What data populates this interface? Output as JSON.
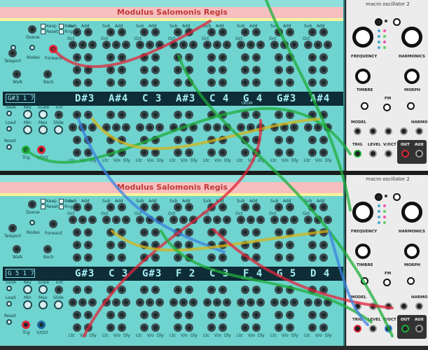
{
  "modules": {
    "msr_title": "Modulus Salomonis Regis",
    "macro_title": "macro oscillator 2"
  },
  "rack1": {
    "display_small": "G#3 1 7",
    "steps": [
      "D#3",
      "A#4",
      "C 3",
      "A#3",
      "C 4",
      "G 4",
      "G#3",
      "A#4"
    ],
    "delim": "DELIM"
  },
  "rack2": {
    "display_small": "G 5 1 7",
    "steps": [
      "G#3",
      "C 3",
      "G#3",
      "F 2",
      "C 3",
      "F 4",
      "G 5",
      "D 4"
    ],
    "delim": "DELIM"
  },
  "msr_labels": {
    "queue": "Queue",
    "keep": "Keep",
    "new": "New",
    "reset": "Reset",
    "rng": "Rng",
    "teleport": "Teleport",
    "nodes": "Nodes",
    "forward": "Forward",
    "walk": "Walk",
    "back": "Back",
    "save": "Save",
    "key": "Key",
    "scale": "Scale",
    "ext": "Ext",
    "load": "Load",
    "min": "Min",
    "max": "Max",
    "slide": "Slide",
    "reset2": "Reset",
    "trig": "Trig",
    "voct": "V/Oct",
    "add": "Add",
    "sub": "Sub",
    "oct": "Oct",
    "ltc": "Ltc",
    "vo": "V/o",
    "dly": "Dly"
  },
  "macro_labels": {
    "frequency": "FREQUENCY",
    "harmonics": "HARMONICS",
    "timbre": "TIMBRE",
    "morph": "MORPH",
    "fm": "FM",
    "model": "MODEL",
    "harmo": "HARMO",
    "trig": "TRIG",
    "level": "LEVEL",
    "voct": "V/OCT",
    "out": "OUT",
    "aux": "AUX"
  },
  "colors": {
    "panel": "#6fd3cf",
    "title_band": "#f7bfbf",
    "display": "#0e2d37",
    "cable_green": "#1fae3a",
    "cable_red": "#e0263a",
    "cable_yellow": "#d6b417",
    "cable_blue": "#3b82e0"
  }
}
